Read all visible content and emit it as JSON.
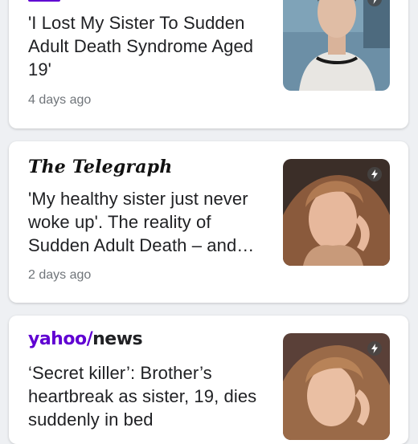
{
  "articles": [
    {
      "source": "",
      "title": "'I Lost My Sister To Sudden Adult Death Syndrome Aged 19'",
      "time": "4 days ago",
      "thumbnail": "young-man-portrait",
      "badge_icon": "lightning-icon"
    },
    {
      "source": "The Telegraph",
      "title": "'My healthy sister just never woke up'. The reality of Sudden Adult Death – and…",
      "time": "2 days ago",
      "thumbnail": "young-woman-portrait",
      "badge_icon": "lightning-icon"
    },
    {
      "source_parts": [
        "yahoo",
        "/",
        "news"
      ],
      "title": "‘Secret killer’: Brother’s heartbreak as sister, 19, dies suddenly in bed",
      "time": "",
      "thumbnail": "young-woman-portrait",
      "badge_icon": "lightning-icon"
    }
  ],
  "colors": {
    "yahoo_purple": "#6001d2",
    "title_text": "#202124",
    "time_text": "#70757a",
    "background": "#eef0f3"
  }
}
